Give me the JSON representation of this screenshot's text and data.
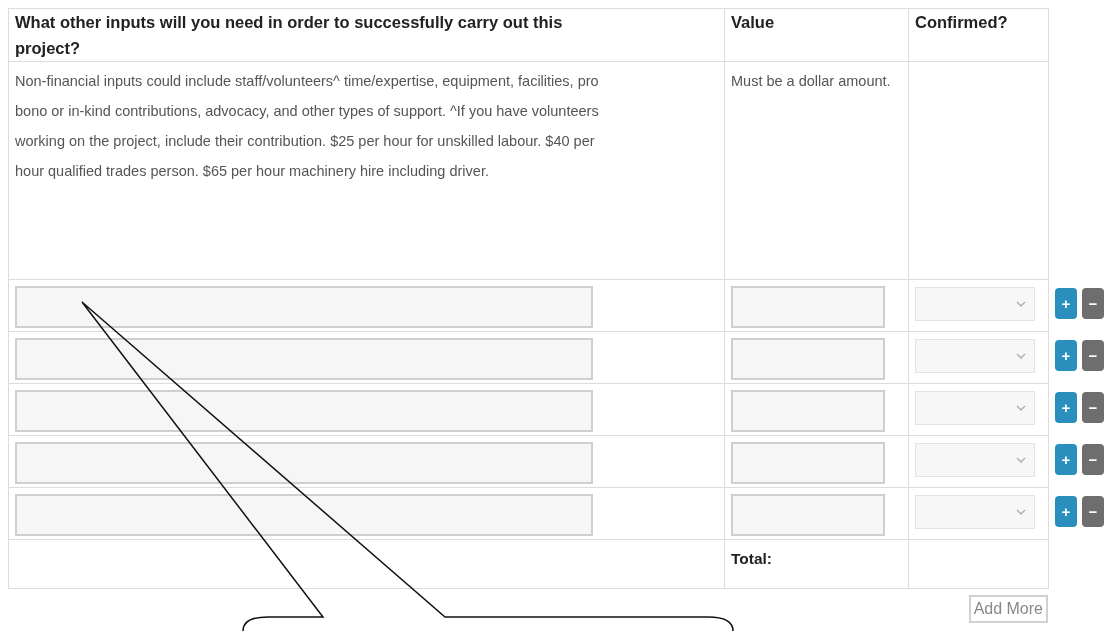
{
  "table": {
    "columns": [
      "What other inputs will you need in order to successfully carry out this project?",
      "Value",
      "Confirmed?"
    ],
    "hints": [
      "Non-financial inputs could include staff/volunteers^ time/expertise, equipment, facilities, pro bono or in-kind contributions, advocacy, and other types of support. ^If you have volunteers working on the project, include their contribution. $25 per hour for unskilled labour. $40 per hour qualified trades person. $65 per hour machinery hire including driver.",
      "Must be a dollar amount."
    ],
    "rows": [
      {
        "add": "+",
        "remove": "−"
      },
      {
        "add": "+",
        "remove": "−"
      },
      {
        "add": "+",
        "remove": "−"
      },
      {
        "add": "+",
        "remove": "−"
      },
      {
        "add": "+",
        "remove": "−"
      }
    ],
    "total_label": "Total:"
  },
  "add_more_button": "Add More"
}
